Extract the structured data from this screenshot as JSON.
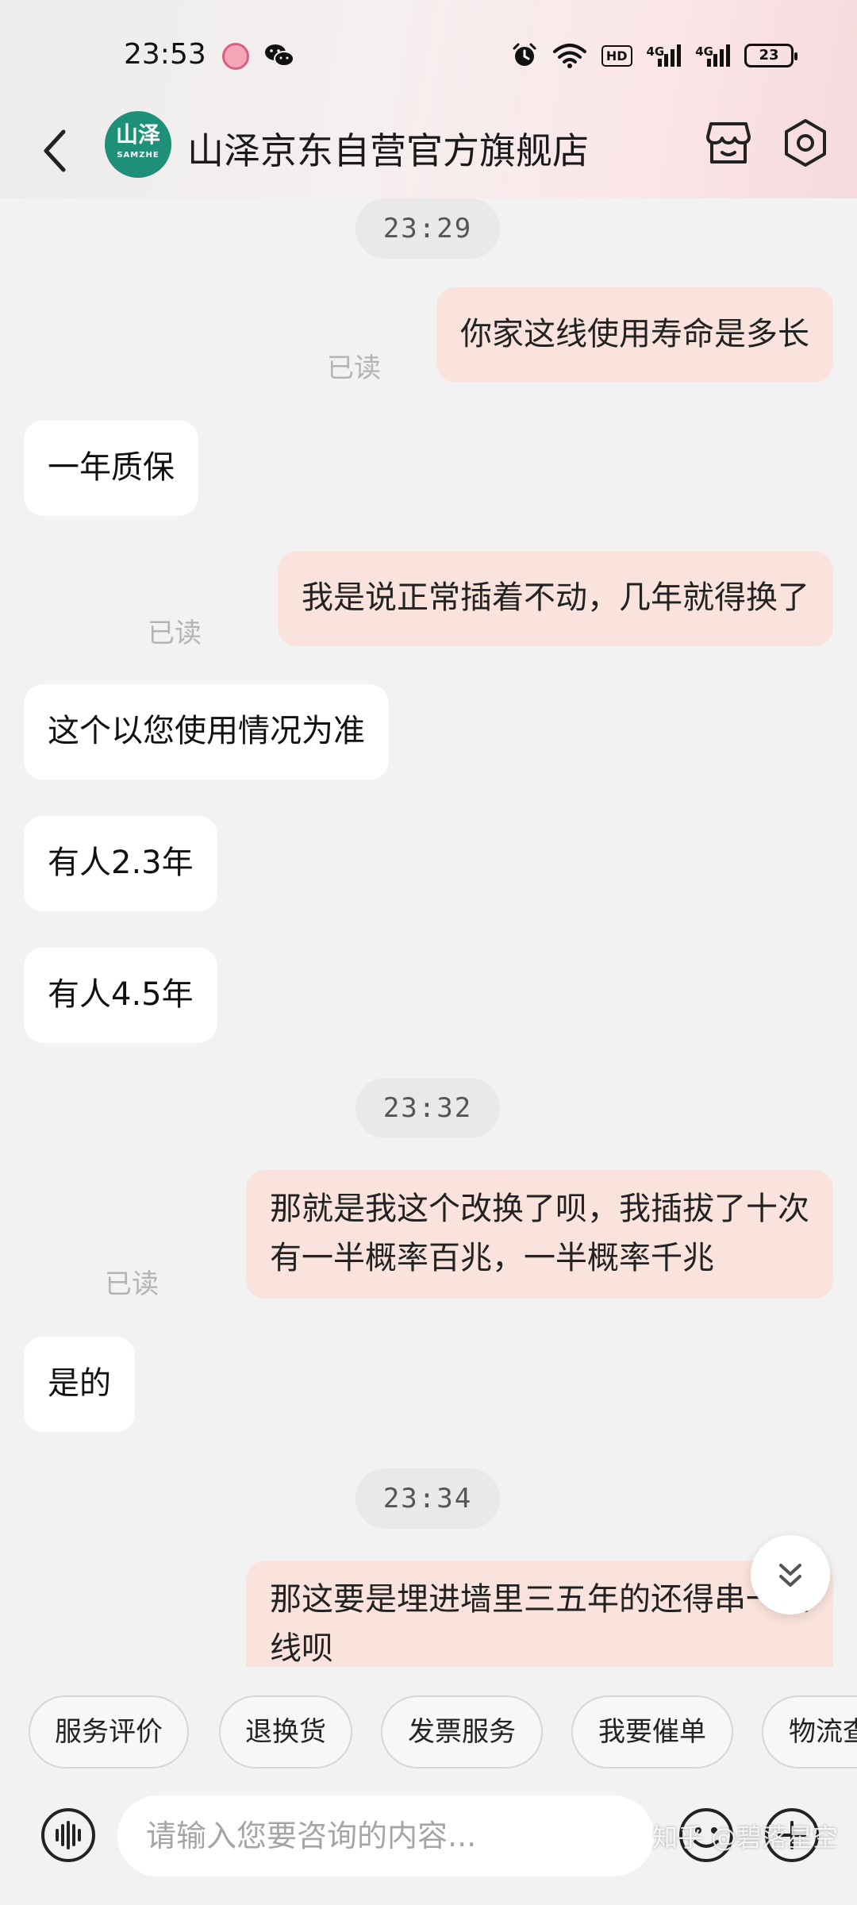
{
  "status_bar": {
    "time": "23:53",
    "hd_badge": "HD",
    "network_1": "4G",
    "network_2": "4G",
    "battery": "23"
  },
  "header": {
    "logo_text_cn": "山泽",
    "logo_text_en": "SAMZHE",
    "store_name": "山泽京东自营官方旗舰店"
  },
  "chat": {
    "time_1": "23:29",
    "msg_1": "你家这线使用寿命是多长",
    "read_1": "已读",
    "msg_2": "一年质保",
    "msg_3": "我是说正常插着不动，几年就得换了",
    "read_2": "已读",
    "msg_4": "这个以您使用情况为准",
    "msg_5": "有人2.3年",
    "msg_6": "有人4.5年",
    "time_2": "23:32",
    "msg_7_line1": "那就是我这个改换了呗，我插拔了十次",
    "msg_7_line2": "有一半概率百兆，一半概率千兆",
    "read_3": "已读",
    "msg_8": "是的",
    "time_3": "23:34",
    "msg_9_line1": "那这要是埋进墙里三五年的还得串一趟",
    "msg_9_line2": "线呗"
  },
  "quick_replies": [
    "服务评价",
    "退换货",
    "发票服务",
    "我要催单",
    "物流查询"
  ],
  "input": {
    "placeholder": "请输入您要咨询的内容..."
  },
  "watermark": "知乎 @碧落星空",
  "colors": {
    "accent_logo": "#1e8f78",
    "outgoing_bubble": "#f9e3dc",
    "incoming_bubble": "#ffffff",
    "background": "#f2f2f2"
  }
}
